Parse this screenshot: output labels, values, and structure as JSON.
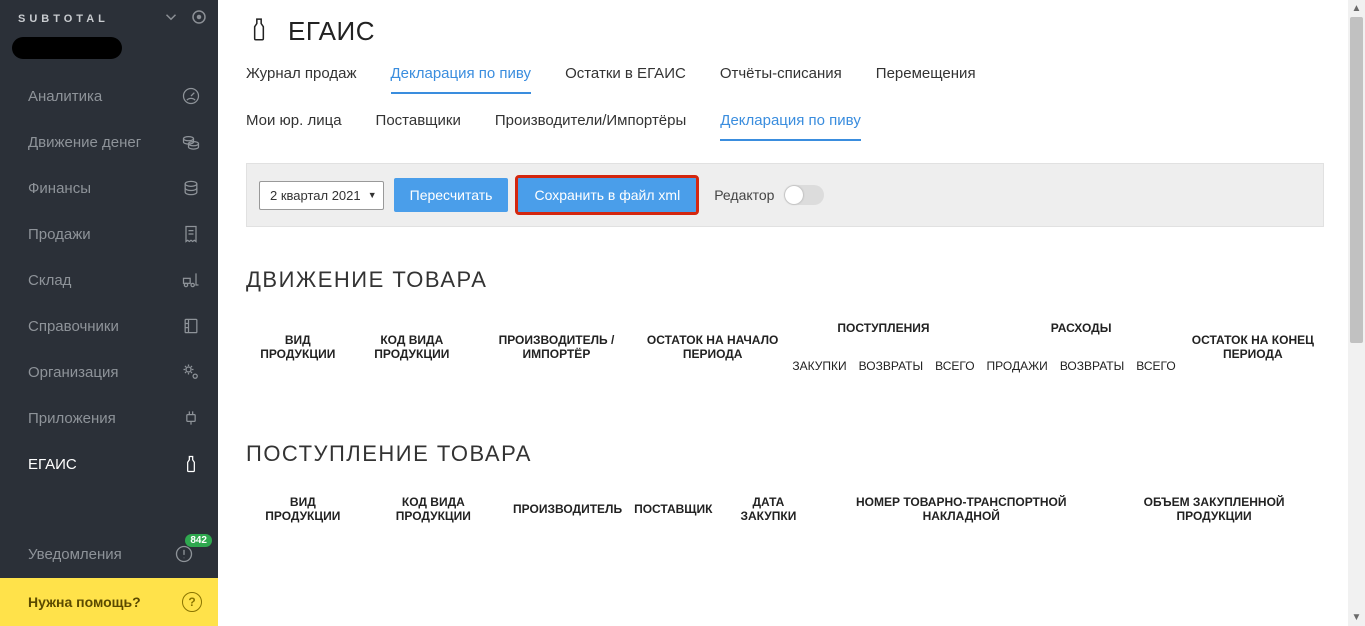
{
  "brand": "SUBTOTAL",
  "sidebar": {
    "items": [
      {
        "label": "Аналитика",
        "icon": "dashboard-icon",
        "active": false
      },
      {
        "label": "Движение денег",
        "icon": "coins-icon",
        "active": false
      },
      {
        "label": "Финансы",
        "icon": "coins2-icon",
        "active": false
      },
      {
        "label": "Продажи",
        "icon": "receipt-icon",
        "active": false
      },
      {
        "label": "Склад",
        "icon": "forklift-icon",
        "active": false
      },
      {
        "label": "Справочники",
        "icon": "book-icon",
        "active": false
      },
      {
        "label": "Организация",
        "icon": "gear-icon",
        "active": false
      },
      {
        "label": "Приложения",
        "icon": "plug-icon",
        "active": false
      },
      {
        "label": "ЕГАИС",
        "icon": "bottle-icon",
        "active": true
      }
    ],
    "notifications": {
      "label": "Уведомления",
      "count": "842"
    },
    "help": "Нужна помощь?"
  },
  "page": {
    "title": "ЕГАИС",
    "tabs": [
      {
        "label": "Журнал продаж",
        "active": false
      },
      {
        "label": "Декларация по пиву",
        "active": true
      },
      {
        "label": "Остатки в ЕГАИС",
        "active": false
      },
      {
        "label": "Отчёты-списания",
        "active": false
      },
      {
        "label": "Перемещения",
        "active": false
      }
    ],
    "subtabs": [
      {
        "label": "Мои юр. лица",
        "active": false
      },
      {
        "label": "Поставщики",
        "active": false
      },
      {
        "label": "Производители/Импортёры",
        "active": false
      },
      {
        "label": "Декларация по пиву",
        "active": true
      }
    ],
    "toolbar": {
      "period": "2 квартал 2021",
      "recalc": "Пересчитать",
      "save_xml": "Сохранить в файл xml",
      "editor_label": "Редактор"
    },
    "movement": {
      "title": "ДВИЖЕНИЕ ТОВАРА",
      "headers": [
        "ВИД ПРОДУКЦИИ",
        "КОД ВИДА ПРОДУКЦИИ",
        "ПРОИЗВОДИТЕЛЬ / ИМПОРТЁР",
        "ОСТАТОК НА НАЧАЛО ПЕРИОДА",
        "ПОСТУПЛЕНИЯ",
        "РАСХОДЫ",
        "ОСТАТОК НА КОНЕЦ ПЕРИОДА"
      ],
      "sub": [
        "ЗАКУПКИ",
        "ВОЗВРАТЫ",
        "ВСЕГО",
        "ПРОДАЖИ",
        "ВОЗВРАТЫ",
        "ВСЕГО"
      ]
    },
    "receipt": {
      "title": "ПОСТУПЛЕНИЕ ТОВАРА",
      "headers": [
        "ВИД ПРОДУКЦИИ",
        "КОД ВИДА ПРОДУКЦИИ",
        "ПРОИЗВОДИТЕЛЬ",
        "ПОСТАВЩИК",
        "ДАТА ЗАКУПКИ",
        "НОМЕР ТОВАРНО-ТРАНСПОРТНОЙ НАКЛАДНОЙ",
        "ОБЪЕМ ЗАКУПЛЕННОЙ ПРОДУКЦИИ"
      ]
    }
  }
}
